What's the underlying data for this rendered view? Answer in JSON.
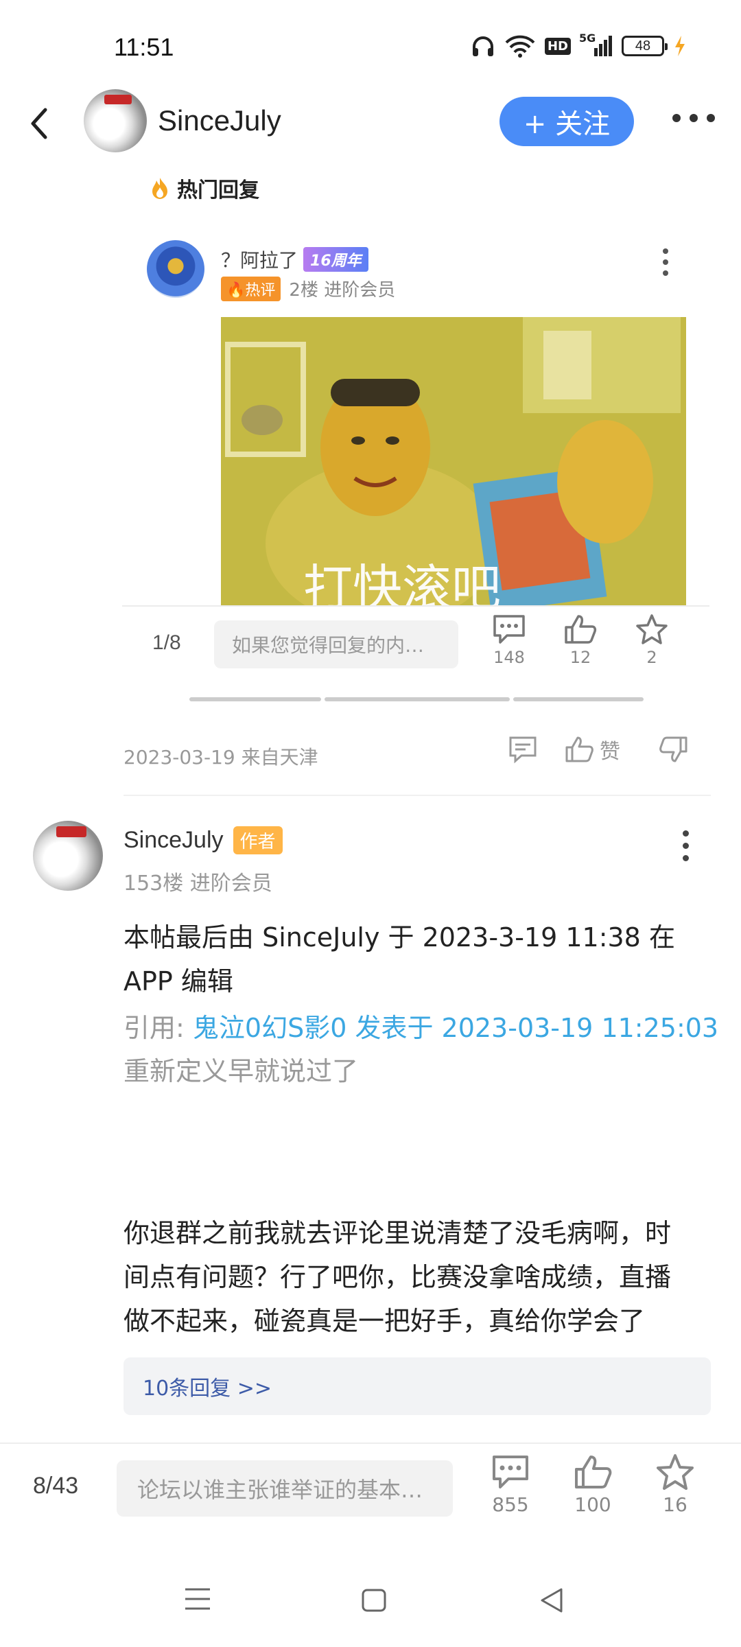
{
  "status": {
    "time": "11:51",
    "hd": "HD",
    "network": "5G",
    "battery": "48"
  },
  "header": {
    "name": "SinceJuly",
    "follow_label": "+ 关注"
  },
  "hot": {
    "label": "热门回复"
  },
  "nested_reply": {
    "username": "？阿拉了",
    "anniversary": "16周年",
    "hot_badge": "热评",
    "meta": "2楼 进阶会员"
  },
  "overlay": {
    "counter": "1/8",
    "input_placeholder": "如果您觉得回复的内…",
    "comments": "148",
    "likes": "12",
    "stars": "2"
  },
  "meta_row": {
    "date_location": "2023-03-19 来自天津",
    "like_label": "赞"
  },
  "comment": {
    "username": "SinceJuly",
    "author_badge": "作者",
    "floor": "153楼 进阶会员",
    "edit_note_1": "本帖最后由 SinceJuly 于 2023-3-19 11:38 在",
    "edit_note_2": "APP 编辑",
    "quote_prefix": "引用: ",
    "quote_source": "鬼泣0幻S影0 发表于 2023-03-19 11:25:03",
    "quote_text": "重新定义早就说过了",
    "body_1": "你退群之前我就去评论里说清楚了没毛病啊，时",
    "body_2": "间点有问题？行了吧你，比赛没拿啥成绩，直播",
    "body_3": "做不起来，碰瓷真是一把好手，真给你学会了",
    "replies_link": "10条回复 >>"
  },
  "bottom": {
    "counter": "8/43",
    "input_placeholder": "论坛以谁主张谁举证的基本…",
    "comments": "855",
    "likes": "100",
    "stars": "16"
  }
}
